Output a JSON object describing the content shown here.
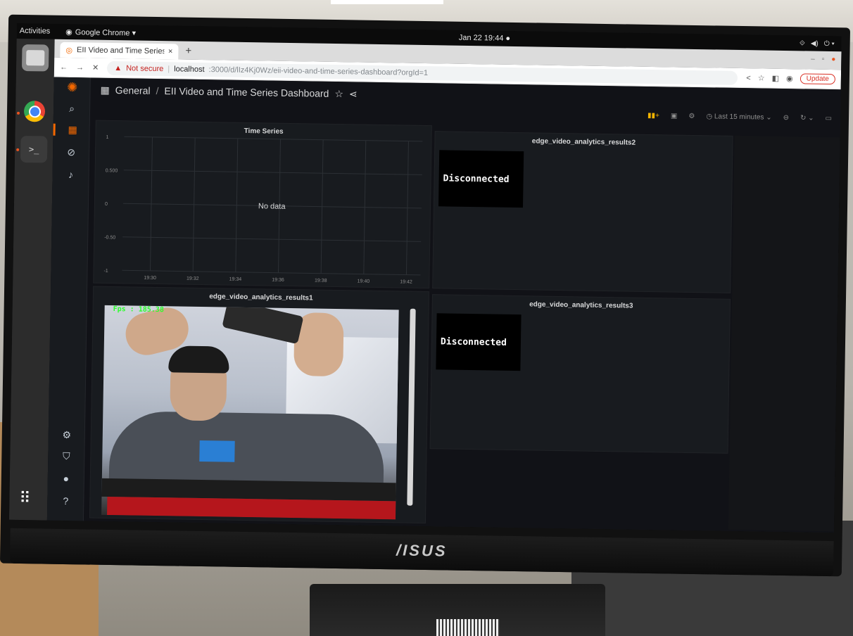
{
  "topbar": {
    "activities": "Activities",
    "app_name": "Google Chrome ▾",
    "clock": "Jan 22  19:44  ●"
  },
  "browser": {
    "tab_title": "EII Video and Time Series",
    "not_secure": "Not secure",
    "url_host": "localhost",
    "url_rest": ":3000/d/lIz4Kj0Wz/eii-video-and-time-series-dashboard?orgId=1",
    "update_label": "Update"
  },
  "grafana": {
    "breadcrumb_folder": "General",
    "breadcrumb_sep": "/",
    "dashboard_title": "EII Video and Time Series Dashboard",
    "time_range": "Last 15 minutes"
  },
  "panels": {
    "time_series": {
      "title": "Time Series",
      "no_data": "No data"
    },
    "results1": {
      "title": "edge_video_analytics_results1",
      "fps_label": "Fps : 185.38"
    },
    "results2": {
      "title": "edge_video_analytics_results2",
      "status": "Disconnected"
    },
    "results3": {
      "title": "edge_video_analytics_results3",
      "status": "Disconnected"
    }
  },
  "chart_data": {
    "type": "line",
    "title": "Time Series",
    "x": [
      "19:30",
      "19:32",
      "19:34",
      "19:36",
      "19:38",
      "19:40",
      "19:42"
    ],
    "y_ticks": [
      "1",
      "0.500",
      "0",
      "-0.50",
      "-1"
    ],
    "ylim": [
      -1,
      1
    ],
    "series": [],
    "grid": true,
    "annotation": "No data"
  },
  "monitor": {
    "brand": "/ISUS"
  }
}
